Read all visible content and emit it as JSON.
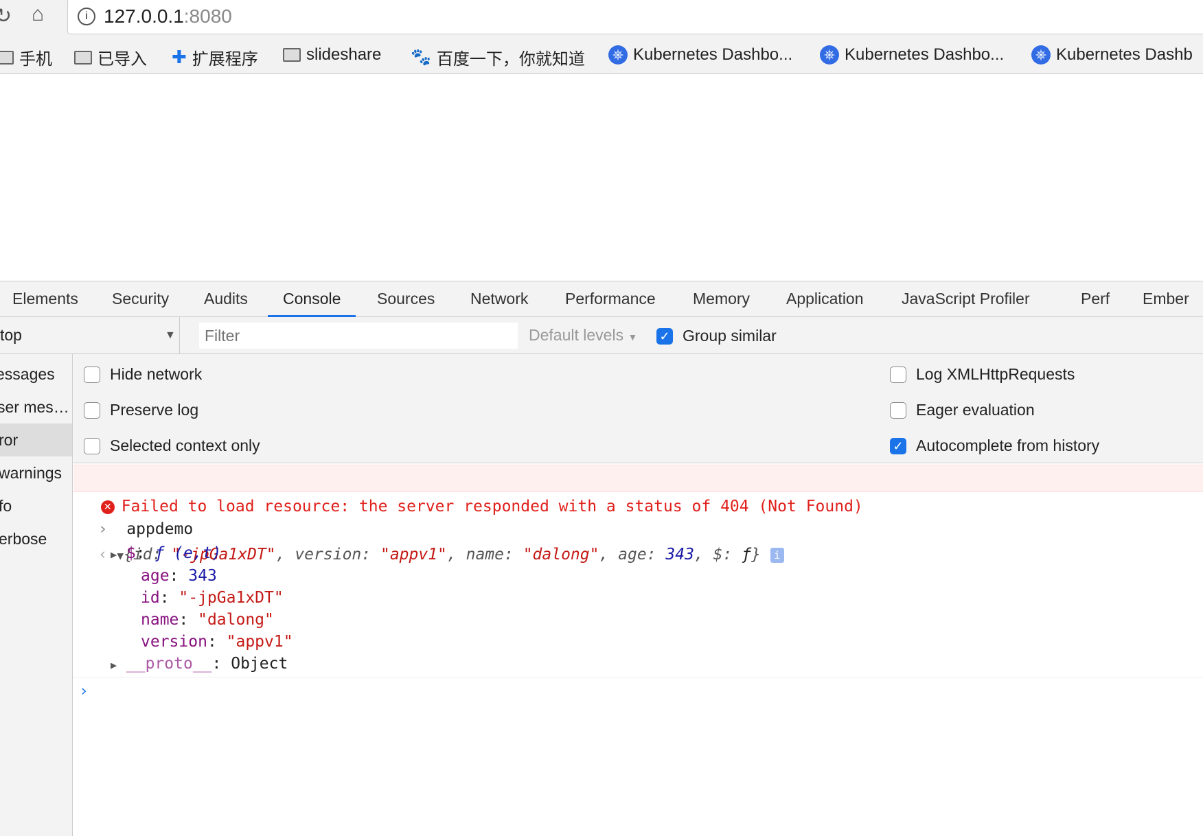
{
  "address_bar": {
    "host": "127.0.0.1",
    "port": ":8080"
  },
  "bookmarks": [
    {
      "label": "手机",
      "icon": "folder-icon"
    },
    {
      "label": "已导入",
      "icon": "folder-icon"
    },
    {
      "label": "扩展程序",
      "icon": "puzzle-icon"
    },
    {
      "label": "slideshare",
      "icon": "folder-icon"
    },
    {
      "label": "百度一下，你就知道",
      "icon": "baidu-paw-icon"
    },
    {
      "label": "Kubernetes Dashbo...",
      "icon": "kubernetes-icon"
    },
    {
      "label": "Kubernetes Dashbo...",
      "icon": "kubernetes-icon"
    },
    {
      "label": "Kubernetes Dashb",
      "icon": "kubernetes-icon"
    }
  ],
  "devtools": {
    "tabs": [
      "Elements",
      "Security",
      "Audits",
      "Console",
      "Sources",
      "Network",
      "Performance",
      "Memory",
      "Application",
      "JavaScript Profiler",
      "Perf",
      "Ember"
    ],
    "active_tab": "Console",
    "toolbar": {
      "context": "top",
      "filter_placeholder": "Filter",
      "levels": "Default levels",
      "group_similar": "Group similar"
    },
    "sidebar": [
      "essages",
      "ser mes…",
      "ror",
      "warnings",
      "fo",
      "erbose"
    ],
    "settings": {
      "left": [
        {
          "label": "Hide network",
          "checked": false
        },
        {
          "label": "Preserve log",
          "checked": false
        },
        {
          "label": "Selected context only",
          "checked": false
        }
      ],
      "right": [
        {
          "label": "Log XMLHttpRequests",
          "checked": false
        },
        {
          "label": "Eager evaluation",
          "checked": false
        },
        {
          "label": "Autocomplete from history",
          "checked": true
        }
      ]
    },
    "console": {
      "error": "Failed to load resource: the server responded with a status of 404 (Not Found)",
      "input": "appdemo",
      "summary": {
        "id": "\"-jpGa1xDT\"",
        "version": "\"appv1\"",
        "name": "\"dalong\"",
        "age": "343",
        "fn": "ƒ"
      },
      "props": {
        "fn_key": "$",
        "fn_val": "ƒ (e,t)",
        "age": "343",
        "id": "\"-jpGa1xDT\"",
        "name": "\"dalong\"",
        "version": "\"appv1\"",
        "proto_key": "__proto__",
        "proto_val": "Object"
      }
    }
  }
}
